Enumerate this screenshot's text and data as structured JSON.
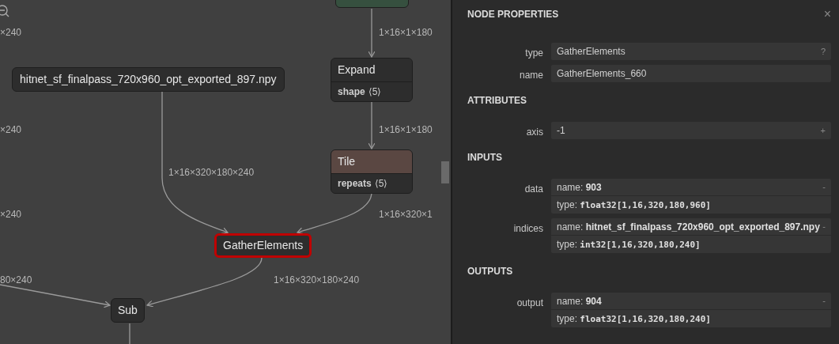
{
  "graph": {
    "nodes": [
      {
        "kind": "op",
        "color": "#36503f",
        "selected": false
      },
      {
        "kind": "op",
        "label": "Expand",
        "color": "#2d2d2d",
        "selected": false,
        "attribute": {
          "name": "shape",
          "value": "⟨5⟩"
        }
      },
      {
        "kind": "op",
        "label": "Tile",
        "color": "#5a4742",
        "selected": false,
        "attribute": {
          "name": "repeats",
          "value": "⟨5⟩"
        }
      },
      {
        "kind": "input",
        "label": "hitnet_sf_finalpass_720x960_opt_exported_897.npy",
        "selected": false
      },
      {
        "kind": "op",
        "label": "GatherElements",
        "color": "#2d2d2d",
        "selected": true
      },
      {
        "kind": "op",
        "label": "Sub",
        "color": "#2d2d2d",
        "selected": false
      }
    ],
    "edge_labels": [
      "×240",
      "1×16×1×180",
      "×240",
      "1×16×1×180",
      "1×16×320×180×240",
      "×240",
      "1×16×320×1",
      "80×240",
      "1×16×320×180×240"
    ]
  },
  "panel": {
    "title": "NODE PROPERTIES",
    "close": "×",
    "sections": [
      {
        "rows": [
          {
            "kind": "field",
            "label": "type",
            "value": "GatherElements",
            "action": "?"
          },
          {
            "kind": "field",
            "label": "name",
            "value": "GatherElements_660"
          }
        ]
      },
      {
        "heading": "ATTRIBUTES",
        "rows": [
          {
            "kind": "field",
            "label": "axis",
            "value": "-1",
            "action": "+"
          }
        ]
      },
      {
        "heading": "INPUTS",
        "rows": [
          {
            "kind": "tensor",
            "label": "data",
            "name_label": "name:",
            "name": "903",
            "type_label": "type:",
            "type": "float32[1,16,320,180,960]",
            "action": "-"
          },
          {
            "kind": "tensor",
            "label": "indices",
            "name_label": "name:",
            "name": "hitnet_sf_finalpass_720x960_opt_exported_897.npy",
            "type_label": "type:",
            "type": "int32[1,16,320,180,240]",
            "action": "-"
          }
        ]
      },
      {
        "heading": "OUTPUTS",
        "rows": [
          {
            "kind": "tensor",
            "label": "output",
            "name_label": "name:",
            "name": "904",
            "type_label": "type:",
            "type": "float32[1,16,320,180,240]",
            "action": "-"
          }
        ]
      }
    ]
  }
}
